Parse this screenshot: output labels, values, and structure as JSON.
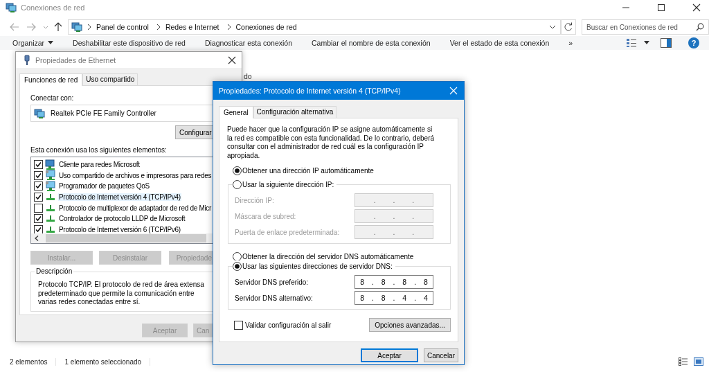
{
  "window": {
    "title": "Conexiones de red"
  },
  "address_bar": {
    "breadcrumbs": [
      "Panel de control",
      "Redes e Internet",
      "Conexiones de red"
    ]
  },
  "search": {
    "placeholder": "Buscar en Conexiones de red"
  },
  "command_bar": {
    "items": [
      "Organizar",
      "Deshabilitar este dispositivo de red",
      "Diagnosticar esta conexión",
      "Cambiar el nombre de esta conexión",
      "Ver el estado de esta conexión"
    ],
    "more": "»",
    "help": "?"
  },
  "content": {
    "fragment": "do"
  },
  "status_bar": {
    "items": [
      "2 elementos",
      "1 elemento seleccionado"
    ]
  },
  "ethernet_dialog": {
    "title": "Propiedades de Ethernet",
    "tabs": [
      {
        "label": "Funciones de red",
        "selected": true
      },
      {
        "label": "Uso compartido",
        "selected": false
      }
    ],
    "connect_label": "Conectar con:",
    "adapter": "Realtek PCIe FE Family Controller",
    "configure_button": "Configurar",
    "elements_label": "Esta conexión usa los siguientes elementos:",
    "elements": [
      {
        "label": "Cliente para redes Microsoft",
        "kind": "client",
        "checked": true,
        "selected": false
      },
      {
        "label": "Uso compartido de archivos e impresoras para redes",
        "kind": "service",
        "checked": true,
        "selected": false
      },
      {
        "label": "Programador de paquetes QoS",
        "kind": "service",
        "checked": true,
        "selected": false
      },
      {
        "label": "Protocolo de Internet versión 4 (TCP/IPv4)",
        "kind": "protocol",
        "checked": true,
        "selected": true
      },
      {
        "label": "Protocolo de multiplexor de adaptador de red de Micr",
        "kind": "protocol",
        "checked": false,
        "selected": false
      },
      {
        "label": "Controlador de protocolo LLDP de Microsoft",
        "kind": "protocol",
        "checked": true,
        "selected": false
      },
      {
        "label": "Protocolo de Internet versión 6 (TCP/IPv6)",
        "kind": "protocol",
        "checked": true,
        "selected": false
      }
    ],
    "buttons": [
      {
        "label": "Instalar...",
        "disabled": true
      },
      {
        "label": "Desinstalar",
        "disabled": true
      },
      {
        "label": "Propiedade",
        "disabled": true
      }
    ],
    "description": {
      "title": "Descripción",
      "text": "Protocolo TCP/IP. El protocolo de red de área extensa predeterminado que permite la comunicación entre varias redes conectadas entre sí."
    },
    "footer_buttons": [
      {
        "label": "Aceptar",
        "disabled": true
      },
      {
        "label": "Can",
        "disabled": true
      }
    ]
  },
  "ipv4_dialog": {
    "title": "Propiedades: Protocolo de Internet versión 4 (TCP/IPv4)",
    "tabs": [
      {
        "label": "General",
        "selected": true
      },
      {
        "label": "Configuración alternativa",
        "selected": false
      }
    ],
    "intro": "Puede hacer que la configuración IP se asigne automáticamente si la red es compatible con esta funcionalidad. De lo contrario, deberá consultar con el administrador de red cuál es la configuración IP apropiada.",
    "ip_options": [
      {
        "label": "Obtener una dirección IP automáticamente",
        "selected": true
      },
      {
        "label": "Usar la siguiente dirección IP:",
        "selected": false
      }
    ],
    "ip_fields": [
      {
        "label": "Dirección IP:",
        "value": ". . .",
        "disabled": true
      },
      {
        "label": "Máscara de subred:",
        "value": ". . .",
        "disabled": true
      },
      {
        "label": "Puerta de enlace predeterminada:",
        "value": ". . .",
        "disabled": true
      }
    ],
    "dns_options": [
      {
        "label": "Obtener la dirección del servidor DNS automáticamente",
        "selected": false
      },
      {
        "label": "Usar las siguientes direcciones de servidor DNS:",
        "selected": true
      }
    ],
    "dns_fields": [
      {
        "label": "Servidor DNS preferido:",
        "value": "8 . 8 . 8 . 8",
        "disabled": false
      },
      {
        "label": "Servidor DNS alternativo:",
        "value": "8 . 8 . 4 . 4",
        "disabled": false
      }
    ],
    "validate": {
      "label": "Validar configuración al salir",
      "checked": false
    },
    "advanced_button": "Opciones avanzadas...",
    "buttons": [
      {
        "label": "Aceptar",
        "default": true
      },
      {
        "label": "Cancelar",
        "default": false
      }
    ]
  }
}
